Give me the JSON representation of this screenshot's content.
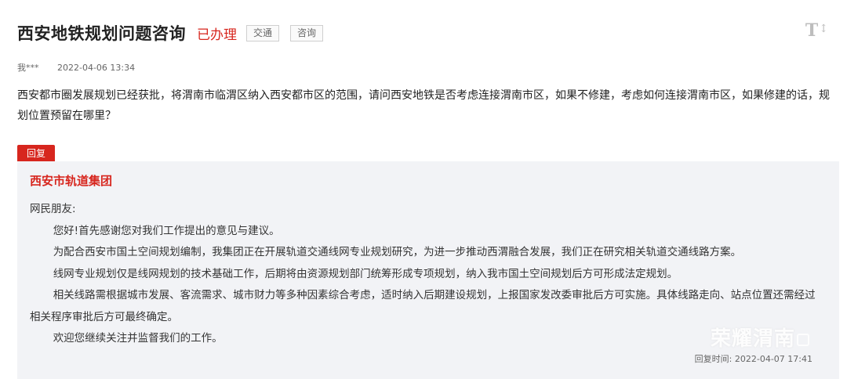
{
  "header": {
    "title": "西安地铁规划问题咨询",
    "status": "已办理",
    "tags": [
      "交通",
      "咨询"
    ],
    "font_toggle": "T",
    "font_toggle_arrow": "↕"
  },
  "meta": {
    "author": "我***",
    "date": "2022-04-06 13:34"
  },
  "question": "西安都市圈发展规划已经获批，将渭南市临渭区纳入西安都市区的范围，请问西安地铁是否考虑连接渭南市区，如果不修建，考虑如何连接渭南市区，如果修建的话，规划位置预留在哪里？",
  "reply": {
    "tag": "回复",
    "org": "西安市轨道集团",
    "greeting": "网民朋友:",
    "paragraphs": [
      "您好!首先感谢您对我们工作提出的意见与建议。",
      "为配合西安市国土空间规划编制，我集团正在开展轨道交通线网专业规划研究，为进一步推动西渭融合发展，我们正在研究相关轨道交通线路方案。",
      "线网专业规划仅是线网规划的技术基础工作，后期将由资源规划部门统筹形成专项规划，纳入我市国土空间规划后方可形成法定规划。",
      "相关线路需根据城市发展、客流需求、城市财力等多种因素综合考虑，适时纳入后期建设规划，上报国家发改委审批后方可实施。具体线路走向、站点位置还需经过相关程序审批后方可最终确定。",
      "欢迎您继续关注并监督我们的工作。"
    ],
    "time_label": "回复时间:",
    "time": "2022-04-07 17:41",
    "watermark": "荣耀渭南"
  },
  "colors": {
    "accent_red": "#d7261e",
    "reply_bg": "#f2f3f6"
  }
}
